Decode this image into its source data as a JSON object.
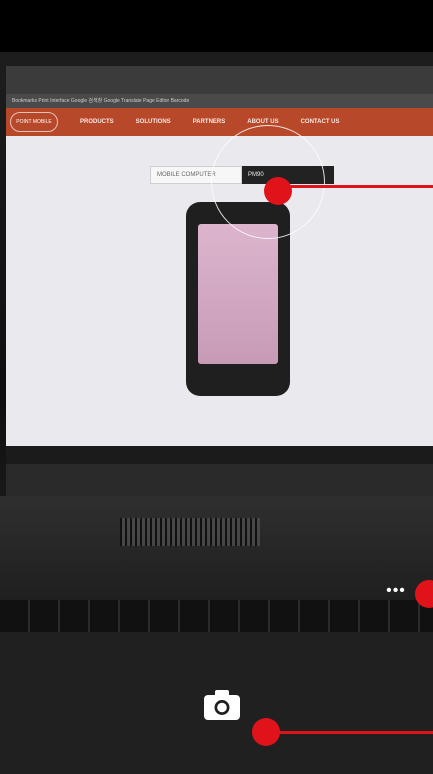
{
  "browser": {
    "bookmarks_text": "Bookmarks  Print Interface  Google 검색창  Google Translate  Page Editor Barcode",
    "nav": {
      "logo": "POINT MOBILE",
      "items": [
        "PRODUCTS",
        "SOLUTIONS",
        "PARTNERS",
        "ABOUT US",
        "CONTACT US"
      ]
    },
    "product_selector": {
      "category": "MOBILE COMPUTER",
      "model": "PM90"
    }
  },
  "controls": {
    "more_label": "•••",
    "capture_icon": "camera-icon"
  },
  "colors": {
    "annotation_red": "#e0131b",
    "bottom_bar": "#202020",
    "site_nav": "#b8482a"
  }
}
